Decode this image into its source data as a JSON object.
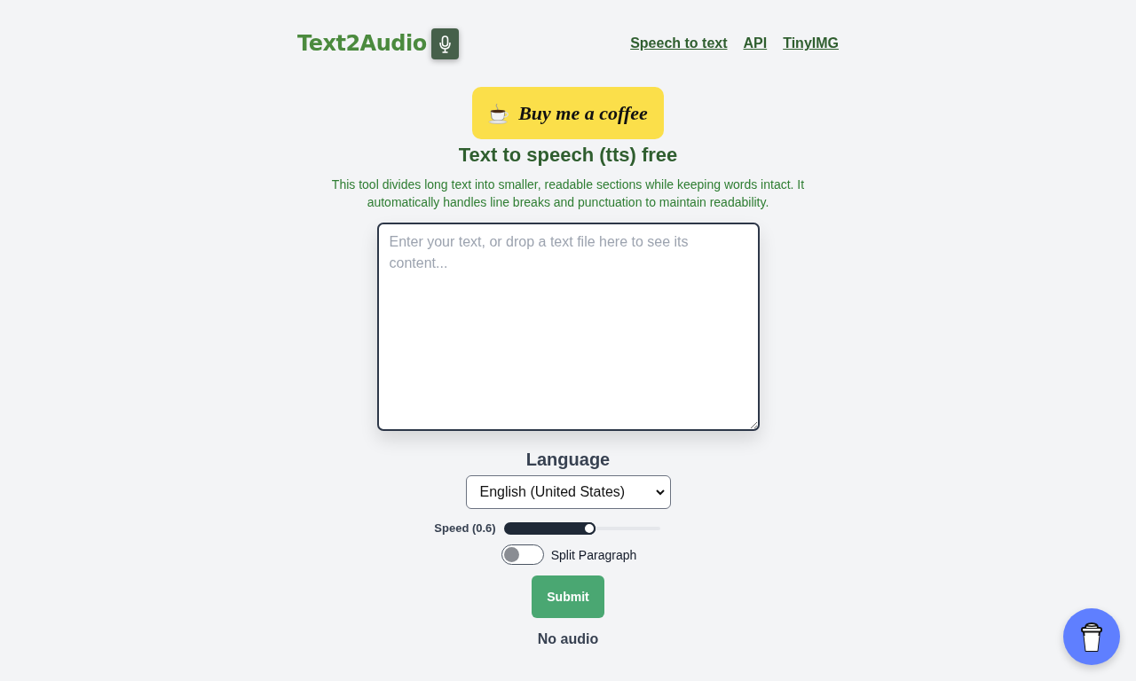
{
  "header": {
    "logo": "Text2Audio",
    "nav_links": [
      "Speech to text",
      "API",
      "TinyIMG"
    ]
  },
  "coffee_button": {
    "label": "Buy me a coffee"
  },
  "title": "Text to speech (tts) free",
  "description": "This tool divides long text into smaller, readable sections while keeping words intact. It automatically handles line breaks and punctuation to maintain readability.",
  "text_input": {
    "placeholder": "Enter your text, or drop a text file here to see its content..."
  },
  "language": {
    "label": "Language",
    "value": "English (United States)"
  },
  "speed": {
    "label": "Speed (0.6)",
    "level": 0.55
  },
  "split_paragraph": {
    "label": "Split Paragraph",
    "on": false
  },
  "submit_button": {
    "label": "Submit"
  },
  "audio_status": "No audio"
}
